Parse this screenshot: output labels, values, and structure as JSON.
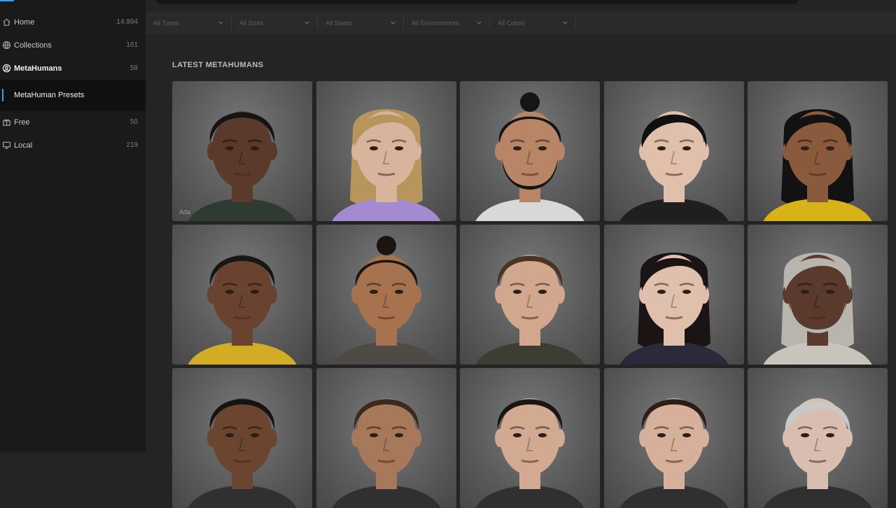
{
  "sidebar": {
    "items": [
      {
        "id": "home",
        "label": "Home",
        "count": "14,994",
        "icon": "home-icon"
      },
      {
        "id": "collections",
        "label": "Collections",
        "count": "161",
        "icon": "globe-icon"
      },
      {
        "id": "metahumans",
        "label": "MetaHumans",
        "count": "58",
        "icon": "user-circle-icon"
      },
      {
        "id": "free",
        "label": "Free",
        "count": "50",
        "icon": "gift-icon"
      },
      {
        "id": "local",
        "label": "Local",
        "count": "219",
        "icon": "monitor-icon"
      }
    ],
    "subitem": {
      "label": "MetaHuman Presets"
    }
  },
  "filters": [
    {
      "label": "All Types"
    },
    {
      "label": "All Sizes"
    },
    {
      "label": "All States"
    },
    {
      "label": "All Environments"
    },
    {
      "label": "All Colors"
    }
  ],
  "section": {
    "title": "LATEST METAHUMANS"
  },
  "cards": [
    {
      "name": "Ada",
      "skin": "#5a3a2a",
      "hair": "#141414",
      "shirt": "#2f3a30",
      "hairstyle": "short-curly"
    },
    {
      "name": "",
      "skin": "#d8b49d",
      "hair": "#b8955c",
      "shirt": "#a48ad0",
      "hairstyle": "long-wavy"
    },
    {
      "name": "",
      "skin": "#b88566",
      "hair": "#151515",
      "shirt": "#d8d8d8",
      "hairstyle": "bun-beard"
    },
    {
      "name": "",
      "skin": "#e0c0ab",
      "hair": "#101010",
      "shirt": "#1f1f1f",
      "hairstyle": "bob"
    },
    {
      "name": "",
      "skin": "#8a5a3c",
      "hair": "#121212",
      "shirt": "#d8b317",
      "hairstyle": "medium"
    },
    {
      "name": "",
      "skin": "#6a4330",
      "hair": "#161616",
      "shirt": "#d2ac22",
      "hairstyle": "short"
    },
    {
      "name": "",
      "skin": "#a7724e",
      "hair": "#1a1511",
      "shirt": "#4e4a44",
      "hairstyle": "bun"
    },
    {
      "name": "",
      "skin": "#d1a88d",
      "hair": "#4a3322",
      "shirt": "#3d3d33",
      "hairstyle": "short"
    },
    {
      "name": "",
      "skin": "#dfc0ac",
      "hair": "#1a1414",
      "shirt": "#2a2a3a",
      "hairstyle": "long"
    },
    {
      "name": "",
      "skin": "#5a3a2c",
      "hair": "#b8b4ae",
      "shirt": "#c8c4bc",
      "hairstyle": "long-beard"
    },
    {
      "name": "",
      "skin": "#6b4530",
      "hair": "#141414",
      "shirt": "#303030",
      "hairstyle": "short-curly"
    },
    {
      "name": "",
      "skin": "#a8785a",
      "hair": "#3a2a1e",
      "shirt": "#303030",
      "hairstyle": "short-curly"
    },
    {
      "name": "",
      "skin": "#d2aa92",
      "hair": "#1a1512",
      "shirt": "#303030",
      "hairstyle": "short"
    },
    {
      "name": "",
      "skin": "#d6b09a",
      "hair": "#2a1e16",
      "shirt": "#303030",
      "hairstyle": "short"
    },
    {
      "name": "",
      "skin": "#d9bdb0",
      "hair": "#c8c8c8",
      "shirt": "#303030",
      "hairstyle": "bob"
    }
  ]
}
